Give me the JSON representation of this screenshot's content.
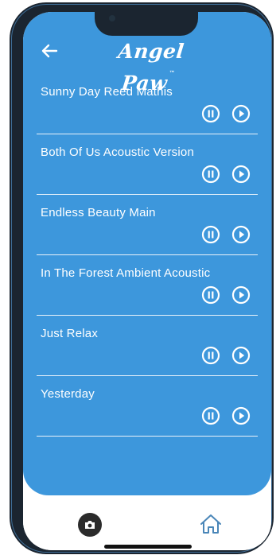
{
  "app": {
    "brand": "Angel Paw",
    "brand_mark": "™",
    "accent_color": "#3d97dc"
  },
  "header": {
    "back_icon": "arrow-left-icon"
  },
  "tracks": [
    {
      "title": "Sunny Day Reed Mathis"
    },
    {
      "title": "Both Of Us Acoustic Version"
    },
    {
      "title": "Endless Beauty Main"
    },
    {
      "title": "In The Forest Ambient Acoustic"
    },
    {
      "title": "Just Relax"
    },
    {
      "title": "Yesterday"
    }
  ],
  "controls": {
    "pause_icon": "pause-circle-icon",
    "play_icon": "play-circle-icon"
  },
  "bottom_nav": {
    "camera_icon": "camera-icon",
    "home_icon": "home-icon"
  }
}
